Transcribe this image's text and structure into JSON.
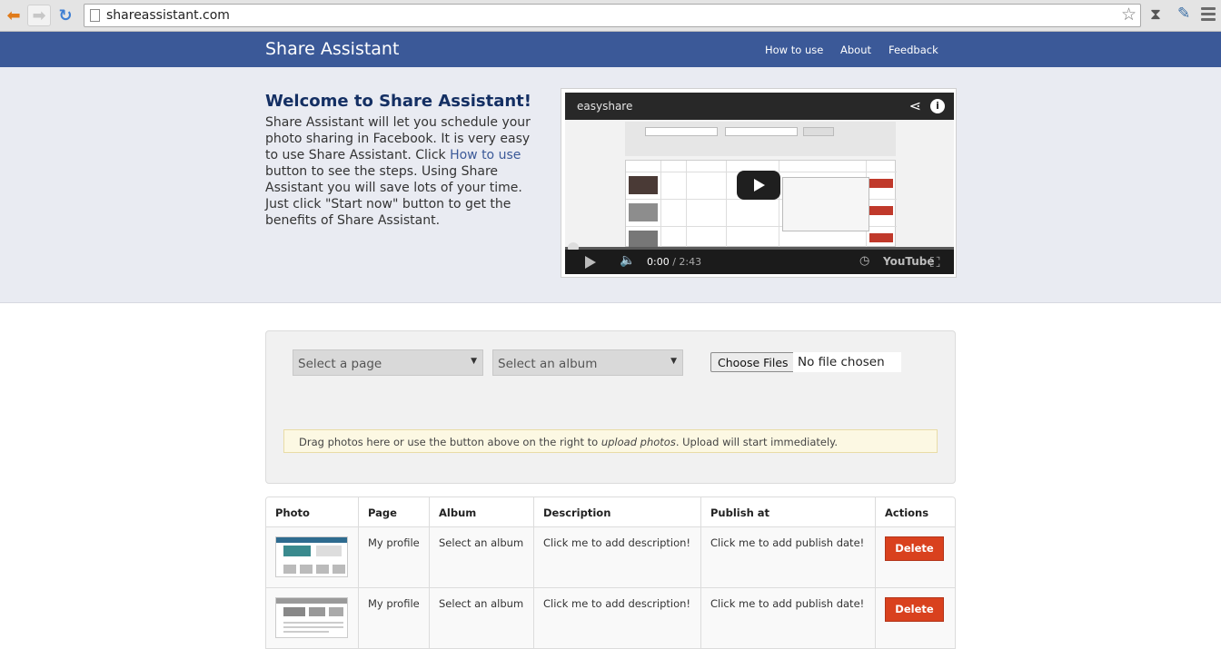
{
  "browser": {
    "url": "shareassistant.com"
  },
  "nav": {
    "brand": "Share Assistant",
    "links": [
      "How to use",
      "About",
      "Feedback"
    ]
  },
  "hero": {
    "title": "Welcome to Share Assistant!",
    "text_before_link": "Share Assistant will let you schedule your photo sharing in Facebook. It is very easy to use Share Assistant. Click ",
    "link": "How to use",
    "text_after_link": " button to see the steps. Using Share Assistant you will save lots of your time. Just click \"Start now\" button to get the benefits of Share Assistant."
  },
  "video": {
    "title": "easyshare",
    "time_current": "0:00",
    "time_total": " / 2:43",
    "logo": "YouTube"
  },
  "upload": {
    "page_select": "Select a page",
    "album_select": "Select an album",
    "choose_files": "Choose Files",
    "no_file": "No file chosen",
    "drop_text_1": "Drag photos here or use the button above on the right to ",
    "drop_text_em": "upload photos",
    "drop_text_2": ". Upload will start immediately."
  },
  "table": {
    "headers": [
      "Photo",
      "Page",
      "Album",
      "Description",
      "Publish at",
      "Actions"
    ],
    "rows": [
      {
        "page": "My profile",
        "album": "Select an album",
        "description": "Click me to add description!",
        "publish": "Click me to add publish date!",
        "action": "Delete",
        "thumb_accent": "#2e6b8f"
      },
      {
        "page": "My profile",
        "album": "Select an album",
        "description": "Click me to add description!",
        "publish": "Click me to add publish date!",
        "action": "Delete",
        "thumb_accent": "#9a9a9a"
      }
    ]
  },
  "colors": {
    "brand": "#3b5998",
    "delete": "#d9411e",
    "dropzone": "#fcf8e3"
  }
}
